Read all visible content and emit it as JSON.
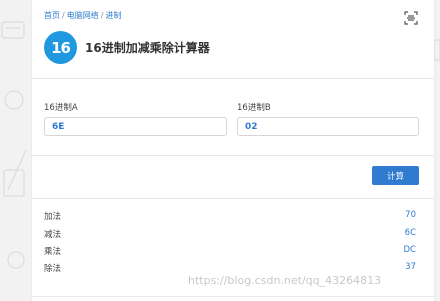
{
  "breadcrumb": {
    "home": "首页",
    "category": "电脑网络",
    "current": "进制",
    "separator": "/"
  },
  "app": {
    "logo_text": "16",
    "title": "16进制加减乘除计算器",
    "accent_color": "#2e7bcf"
  },
  "inputs": {
    "a_label": "16进制A",
    "a_value": "6E",
    "b_label": "16进制B",
    "b_value": "02"
  },
  "actions": {
    "calculate_label": "计算"
  },
  "results": [
    {
      "label": "加法",
      "value": "70"
    },
    {
      "label": "减法",
      "value": "6C"
    },
    {
      "label": "乘法",
      "value": "DC"
    },
    {
      "label": "除法",
      "value": "37"
    }
  ],
  "watermark": "https://blog.csdn.net/qq_43264813",
  "icons": {
    "scan": "scan-icon"
  }
}
